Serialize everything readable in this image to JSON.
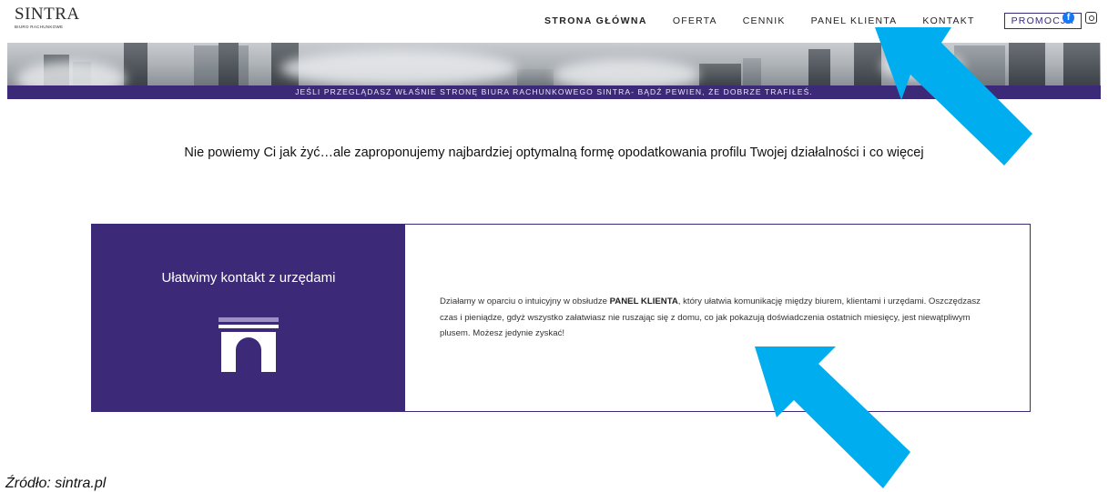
{
  "header": {
    "logo_main": "SINTRA",
    "logo_sub": "BIURO RACHUNKOWE",
    "nav": [
      {
        "label": "STRONA GŁÓWNA",
        "active": true
      },
      {
        "label": "OFERTA"
      },
      {
        "label": "CENNIK"
      },
      {
        "label": "PANEL KLIENTA"
      },
      {
        "label": "KONTAKT"
      }
    ],
    "promo_label": "PROMOCJA",
    "social_icons": [
      "facebook-icon",
      "instagram-icon"
    ]
  },
  "banner": {
    "tagline": "JEŚLI PRZEGLĄDASZ WŁAŚNIE STRONĘ BIURA RACHUNKOWEGO SINTRA- BĄDŹ PEWIEN, ŻE DOBRZE TRAFIŁEŚ."
  },
  "headline": "Nie powiemy Ci jak żyć…ale zaproponujemy najbardziej optymalną formę opodatkowania profilu Twojej działalności i co więcej",
  "feature": {
    "title": "Ułatwimy kontakt z urzędami",
    "icon": "building-gate-icon",
    "text_before": "Działamy w oparciu o intuicyjny w obsłudze ",
    "text_bold": "PANEL KLIENTA",
    "text_after": ", który ułatwia komunikację między biurem, klientami i urzędami. Oszczędzasz czas i pieniądze, gdyż wszystko załatwiasz nie ruszając się z domu, co jak pokazują doświadczenia ostatnich miesięcy, jest niewątpliwym plusem. Możesz jedynie zyskać!"
  },
  "source": "Źródło: sintra.pl",
  "colors": {
    "brand_purple": "#3c2a78",
    "arrow_blue": "#00aeef",
    "facebook_blue": "#1877f2"
  }
}
